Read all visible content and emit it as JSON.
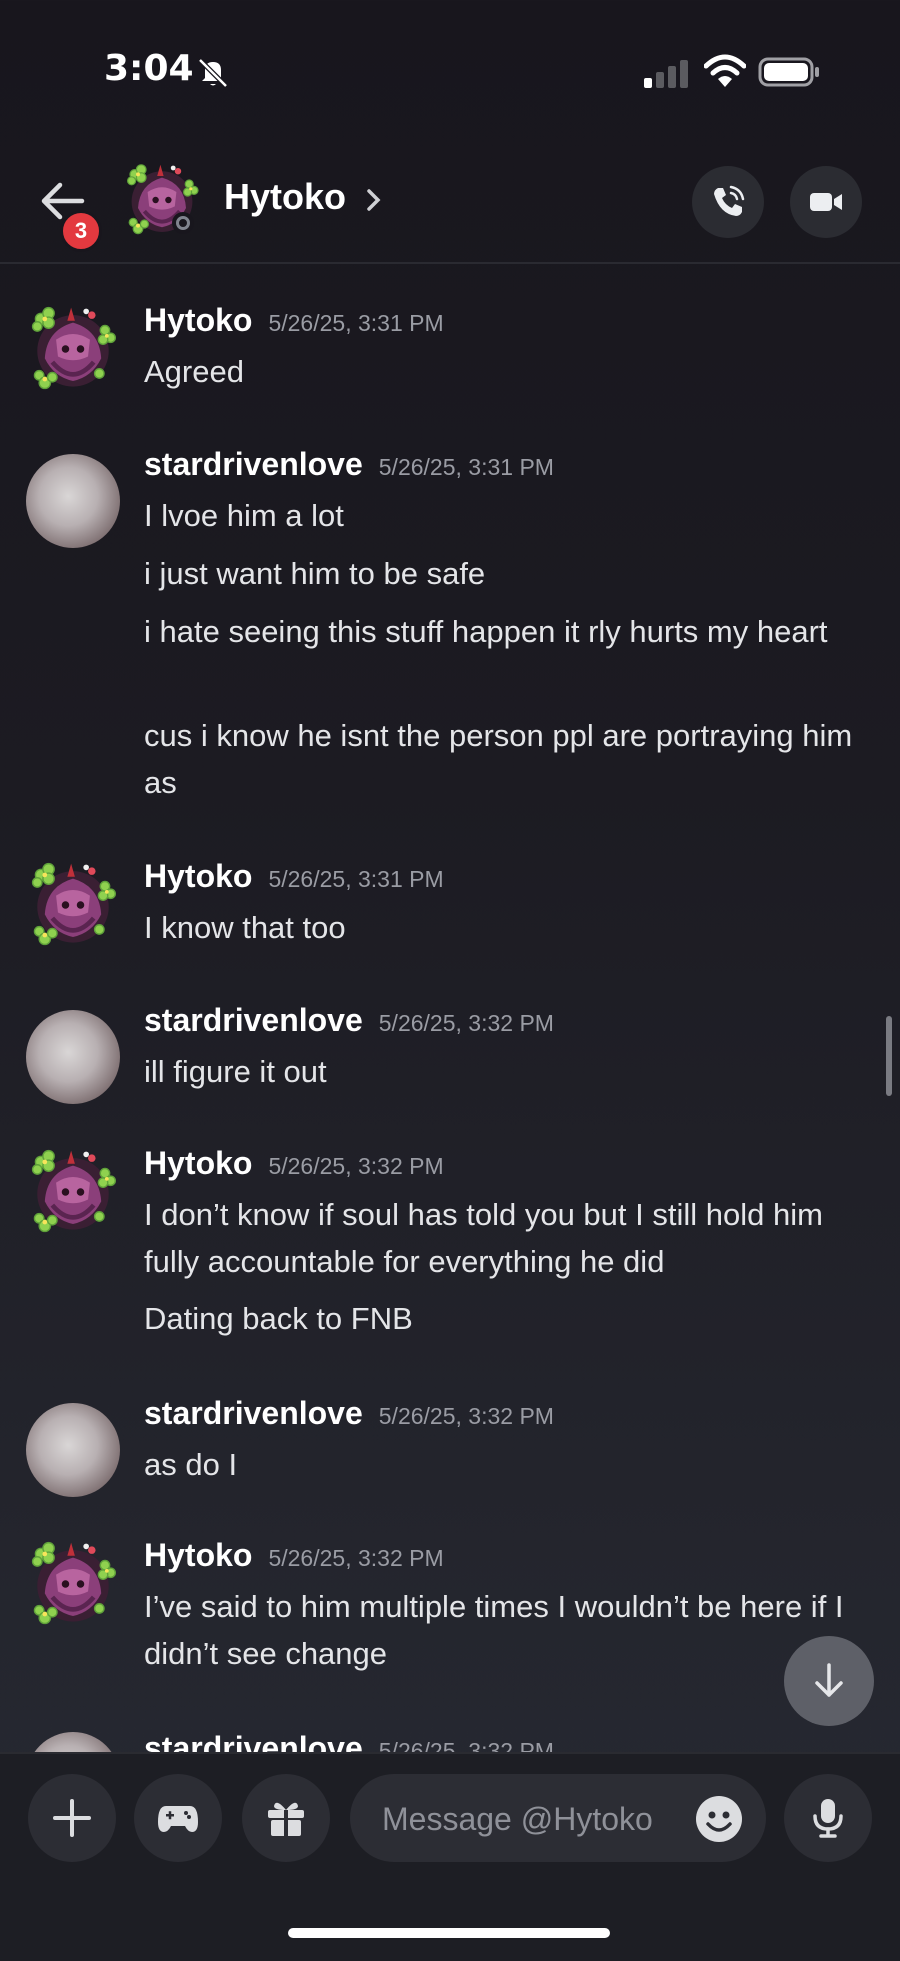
{
  "status_bar": {
    "time": "3:04"
  },
  "header": {
    "back_badge": "3",
    "name": "Hytoko"
  },
  "messages": [
    {
      "author": "Hytoko",
      "timestamp": "5/26/25, 3:31 PM",
      "lines": [
        "Agreed"
      ]
    },
    {
      "author": "stardrivenlove",
      "timestamp": "5/26/25, 3:31 PM",
      "lines": [
        "I lvoe him a lot",
        "i just want him to be safe",
        "i hate seeing this stuff happen it rly hurts my heart",
        "cus i know he isnt the person ppl are portraying him as"
      ]
    },
    {
      "author": "Hytoko",
      "timestamp": "5/26/25, 3:31 PM",
      "lines": [
        "I know that too"
      ]
    },
    {
      "author": "stardrivenlove",
      "timestamp": "5/26/25, 3:32 PM",
      "lines": [
        "ill figure it out"
      ]
    },
    {
      "author": "Hytoko",
      "timestamp": "5/26/25, 3:32 PM",
      "lines": [
        "I don’t know if soul has told you but I still hold him fully accountable for everything he did",
        "Dating back to FNB"
      ]
    },
    {
      "author": "stardrivenlove",
      "timestamp": "5/26/25, 3:32 PM",
      "lines": [
        "as do I"
      ]
    },
    {
      "author": "Hytoko",
      "timestamp": "5/26/25, 3:32 PM",
      "lines": [
        "I’ve said to him multiple times I wouldn’t be here if I didn’t see change"
      ]
    },
    {
      "author": "stardrivenlove",
      "timestamp": "5/26/25, 3:32 PM",
      "lines": []
    }
  ],
  "composer": {
    "placeholder": "Message @Hytoko"
  },
  "colors": {
    "background": "#1c1b22",
    "badge": "#e3393f",
    "button": "#2c2d34",
    "text": "#e4e5e8",
    "timestamp": "#9a9ca4"
  },
  "icons": [
    "back-arrow-icon",
    "bell-muted-icon",
    "voice-call-icon",
    "video-call-icon",
    "plus-icon",
    "gamepad-icon",
    "gift-icon",
    "emoji-icon",
    "microphone-icon",
    "arrow-down-icon"
  ]
}
